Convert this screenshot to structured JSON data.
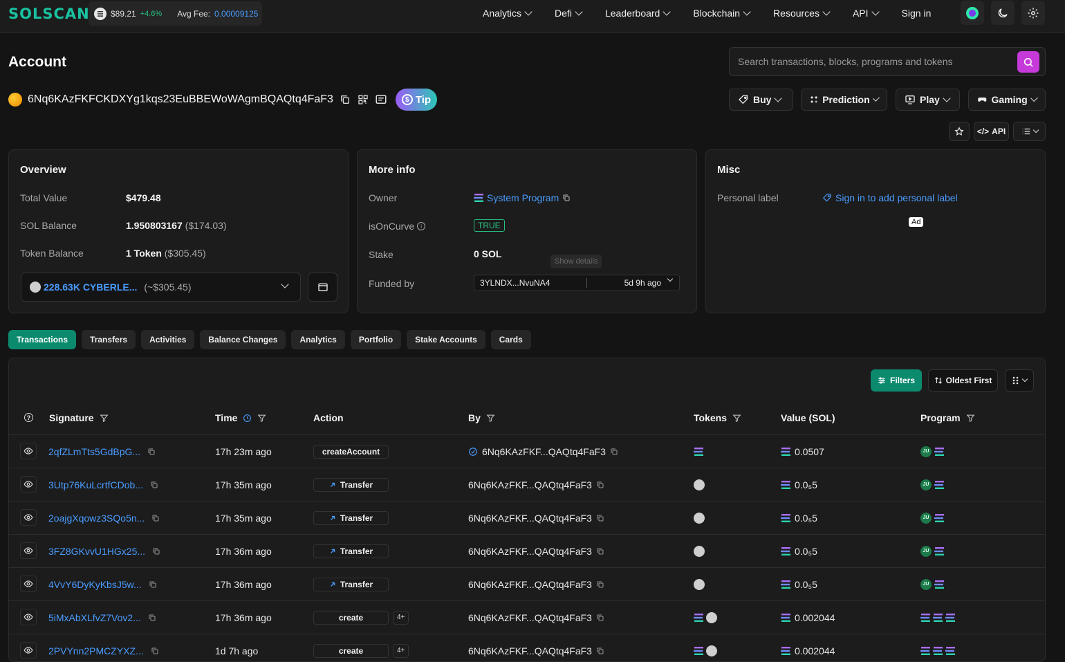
{
  "brand": {
    "logo": "SOLSCAN"
  },
  "ticker": {
    "price": "$89.21",
    "change": "+4.6%",
    "fee_label": "Avg Fee:",
    "fee_value": "0.00009125"
  },
  "nav": {
    "items": [
      "Analytics",
      "Defi",
      "Leaderboard",
      "Blockchain",
      "Resources",
      "API"
    ],
    "sign_in": "Sign in"
  },
  "page": {
    "title": "Account"
  },
  "search": {
    "placeholder": "Search transactions, blocks, programs and tokens"
  },
  "account": {
    "address": "6Nq6KAzFKFCKDXYg1kqs23EuBBEWoWAgmBQAQtq4FaF3",
    "tip_label": "Tip"
  },
  "quick_actions": {
    "buy": "Buy",
    "prediction": "Prediction",
    "play": "Play",
    "gaming": "Gaming",
    "api": "API"
  },
  "overview": {
    "title": "Overview",
    "total_value_label": "Total Value",
    "total_value": "$479.48",
    "sol_balance_label": "SOL Balance",
    "sol_balance": "1.950803167",
    "sol_balance_usd": "($174.03)",
    "token_balance_label": "Token Balance",
    "token_balance": "1 Token",
    "token_balance_usd": "($305.45)",
    "token_select": "228.63K CYBERLE...",
    "token_select_usd": "(~$305.45)"
  },
  "more_info": {
    "title": "More info",
    "owner_label": "Owner",
    "owner": "System Program",
    "curve_label": "isOnCurve",
    "curve": "TRUE",
    "stake_label": "Stake",
    "stake": "0 SOL",
    "funded_label": "Funded by",
    "funded_addr": "3YLNDX...NvuNA4",
    "funded_time": "5d 9h ago",
    "tooltip": "Show details"
  },
  "misc": {
    "title": "Misc",
    "label": "Personal label",
    "link": "Sign in to add personal label",
    "ad": "Ad"
  },
  "tabs": [
    "Transactions",
    "Transfers",
    "Activities",
    "Balance Changes",
    "Analytics",
    "Portfolio",
    "Stake Accounts",
    "Cards"
  ],
  "table": {
    "filters": "Filters",
    "sort": "Oldest First",
    "columns": {
      "signature": "Signature",
      "time": "Time",
      "action": "Action",
      "by": "By",
      "tokens": "Tokens",
      "value": "Value (SOL)",
      "program": "Program"
    },
    "rows": [
      {
        "sig": "2qfZLmTts5GdBpG...",
        "time": "17h 23m ago",
        "action": "createAccount",
        "by": "6Nq6KAzFKF...QAQtq4FaF3",
        "value": "0.0507",
        "more": ""
      },
      {
        "sig": "3Utp76KuLcrtfCDob...",
        "time": "17h 35m ago",
        "action": "Transfer",
        "by": "6Nq6KAzFKF...QAQtq4FaF3",
        "value": "0.0₅5",
        "more": ""
      },
      {
        "sig": "2oajgXqowz3SQo5n...",
        "time": "17h 35m ago",
        "action": "Transfer",
        "by": "6Nq6KAzFKF...QAQtq4FaF3",
        "value": "0.0₅5",
        "more": ""
      },
      {
        "sig": "3FZ8GKvvU1HGx25...",
        "time": "17h 36m ago",
        "action": "Transfer",
        "by": "6Nq6KAzFKF...QAQtq4FaF3",
        "value": "0.0₅5",
        "more": ""
      },
      {
        "sig": "4VvY6DyKyKbsJ5w...",
        "time": "17h 36m ago",
        "action": "Transfer",
        "by": "6Nq6KAzFKF...QAQtq4FaF3",
        "value": "0.0₅5",
        "more": ""
      },
      {
        "sig": "5iMxAbXLfvZ7Vov2...",
        "time": "17h 36m ago",
        "action": "create",
        "by": "6Nq6KAzFKF...QAQtq4FaF3",
        "value": "0.002044",
        "more": "4+"
      },
      {
        "sig": "2PVYnn2PMCZYXZ...",
        "time": "1d 7h ago",
        "action": "create",
        "by": "6Nq6KAzFKF...QAQtq4FaF3",
        "value": "0.002044",
        "more": "4+"
      }
    ]
  },
  "colors": {
    "accent": "#19c2a1",
    "link": "#4a9cff",
    "active_tab": "#0c8a6e",
    "positive": "#26c281",
    "search_button": "#c53ad9"
  }
}
